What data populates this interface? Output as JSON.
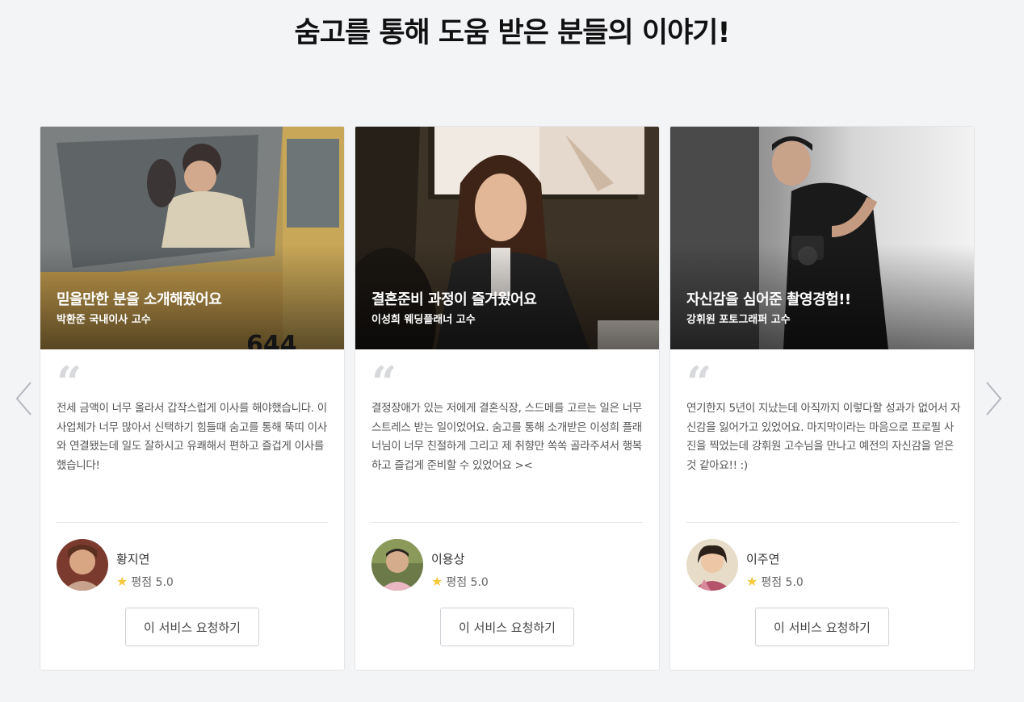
{
  "page": {
    "title": "숨고를 통해 도움 받은 분들의 이야기!"
  },
  "cards": [
    {
      "headline": "믿을만한 분을 소개해줬어요",
      "pro": "박환준 국내이사 고수",
      "quote": "전세 금액이 너무 올라서 갑작스럽게 이사를 해야했습니다. 이사업체가 너무 많아서 신택하기 힘들때 숨고를 통해 뚝띠 이사와 연결됐는데 일도 잘하시고 유쾌해서 편하고 즐겁게 이사를 했습니다!",
      "reviewer": "황지연",
      "rating": "평점 5.0",
      "button": "이 서비스 요청하기"
    },
    {
      "headline": "결혼준비 과정이 즐거웠어요",
      "pro": "이성희 웨딩플래너 고수",
      "quote": "결정장애가 있는 저에게 결혼식장, 스드메를 고르는 일은 너무 스트레스 받는 일이었어요. 숨고를 통해 소개받은 이성희 플래너님이 너무 친절하게 그리고 제 취향만 쏙쏙 골라주셔서 행복하고 즐겁게 준비할 수 있었어요 ><",
      "reviewer": "이용상",
      "rating": "평점 5.0",
      "button": "이 서비스 요청하기"
    },
    {
      "headline": "자신감을 심어준 촬영경험!!",
      "pro": "강휘원 포토그래퍼 고수",
      "quote": "연기한지 5년이 지났는데 아직까지 이렇다할 성과가 없어서 자신감을 잃어가고 있었어요. 마지막이라는 마음으로 프로필 사진을 찍었는데 강휘원 고수님을 만나고 예전의 자신감을 얻은 것 같아요!! :)",
      "reviewer": "이주연",
      "rating": "평점 5.0",
      "button": "이 서비스 요청하기"
    }
  ],
  "icons": {
    "quote": "“",
    "star": "★",
    "prev": "chevron-left-icon",
    "next": "chevron-right-icon"
  },
  "colors": {
    "star": "#f7c73a",
    "background": "#f3f4f6"
  }
}
